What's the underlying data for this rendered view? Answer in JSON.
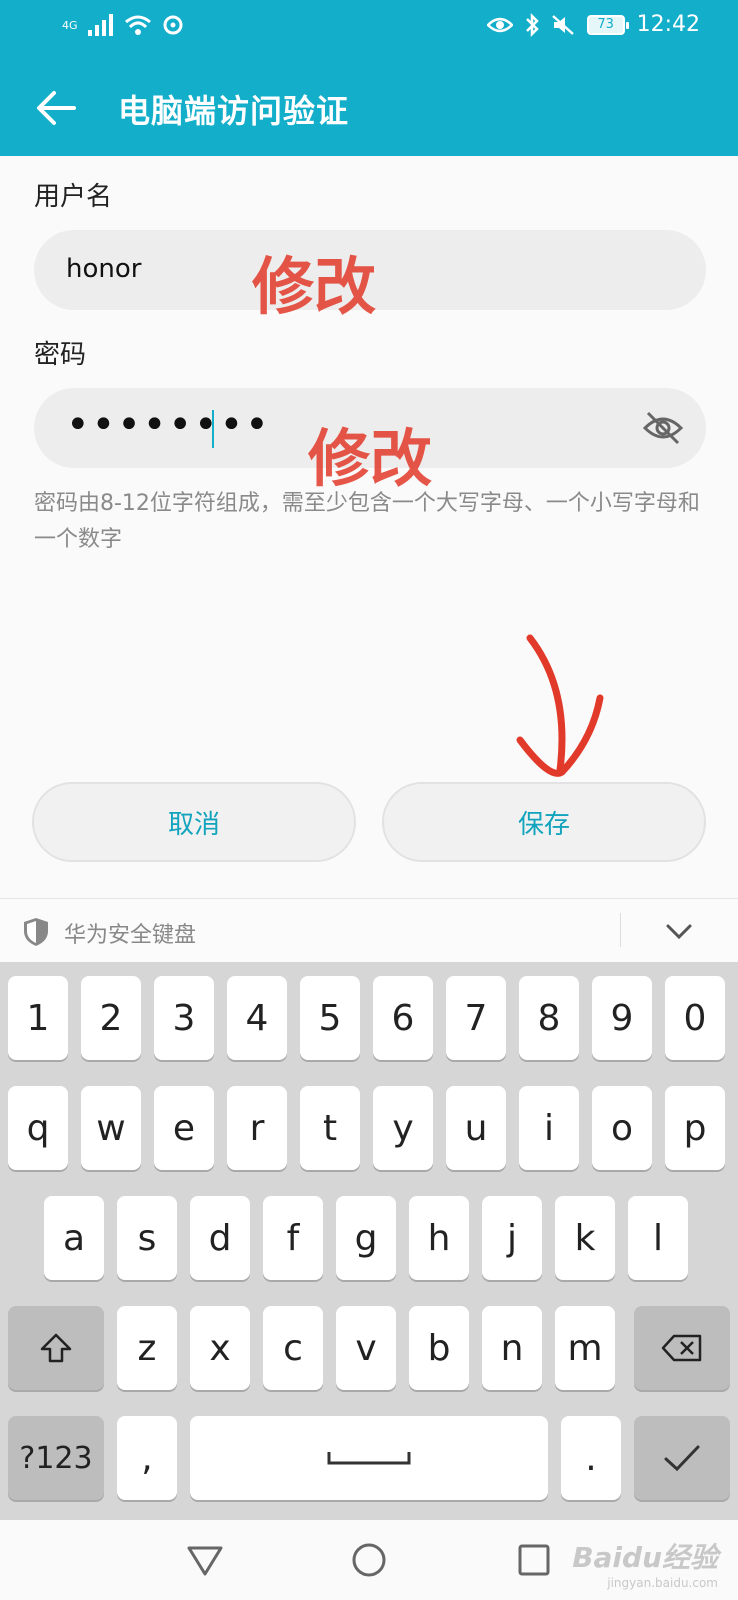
{
  "status_bar": {
    "network": "4G",
    "battery": "73",
    "time": "12:42"
  },
  "app_bar": {
    "title": "电脑端访问验证"
  },
  "form": {
    "username_label": "用户名",
    "username_value": "honor",
    "password_label": "密码",
    "password_masked": "••••••••",
    "hint": "密码由8-12位字符组成，需至少包含一个大写字母、一个小写字母和一个数字"
  },
  "annotations": {
    "edit_username": "修改",
    "edit_password": "修改"
  },
  "buttons": {
    "cancel": "取消",
    "save": "保存"
  },
  "keyboard": {
    "title": "华为安全键盘",
    "row1": [
      "1",
      "2",
      "3",
      "4",
      "5",
      "6",
      "7",
      "8",
      "9",
      "0"
    ],
    "row2": [
      "q",
      "w",
      "e",
      "r",
      "t",
      "y",
      "u",
      "i",
      "o",
      "p"
    ],
    "row3": [
      "a",
      "s",
      "d",
      "f",
      "g",
      "h",
      "j",
      "k",
      "l"
    ],
    "row4": [
      "z",
      "x",
      "c",
      "v",
      "b",
      "n",
      "m"
    ],
    "symbols_key": "?123",
    "comma_key": ",",
    "period_key": "."
  },
  "watermark": {
    "brand": "Baidu经验",
    "url": "jingyan.baidu.com"
  },
  "colors": {
    "accent": "#12aeca",
    "annotation": "#e23a2a"
  }
}
